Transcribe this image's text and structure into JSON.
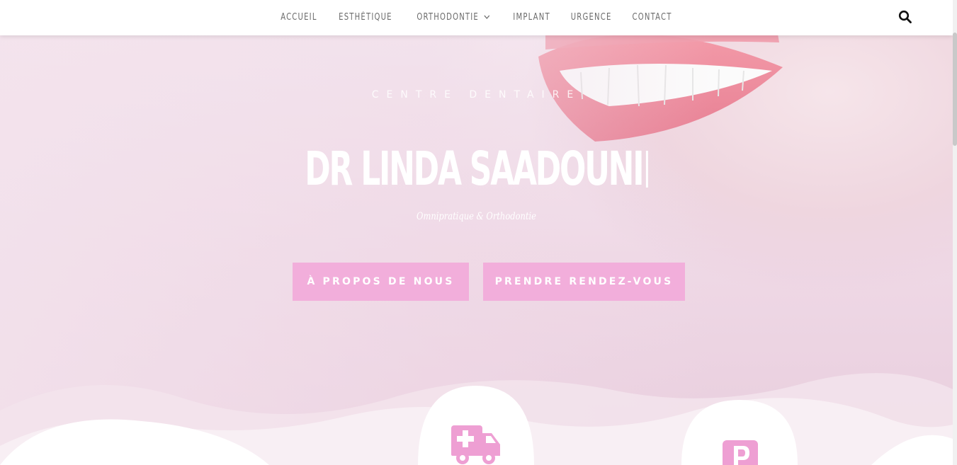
{
  "nav": {
    "items": [
      "Accueil",
      "Esthétique",
      "Orthodontie",
      "Implant",
      "Urgence",
      "Contact"
    ],
    "dropdown_item_index": 2
  },
  "hero": {
    "eyebrow": "CENTRE DENTAIRE",
    "title": "DR LINDA SAADOUNI",
    "subtitle": "Omnipratique & Orthodontie",
    "buttons": {
      "about": "À PROPOS DE NOUS",
      "appointment": "PRENDRE RENDEZ-VOUS"
    }
  },
  "colors": {
    "accent_pink": "#f2aedb",
    "icon_pink": "#ee9fd3",
    "nav_text": "#6b6b6b"
  },
  "icons": {
    "search": "search-icon",
    "dropdown": "chevron-down-icon",
    "feature_1": "ambulance-icon",
    "feature_2": "parking-icon"
  }
}
